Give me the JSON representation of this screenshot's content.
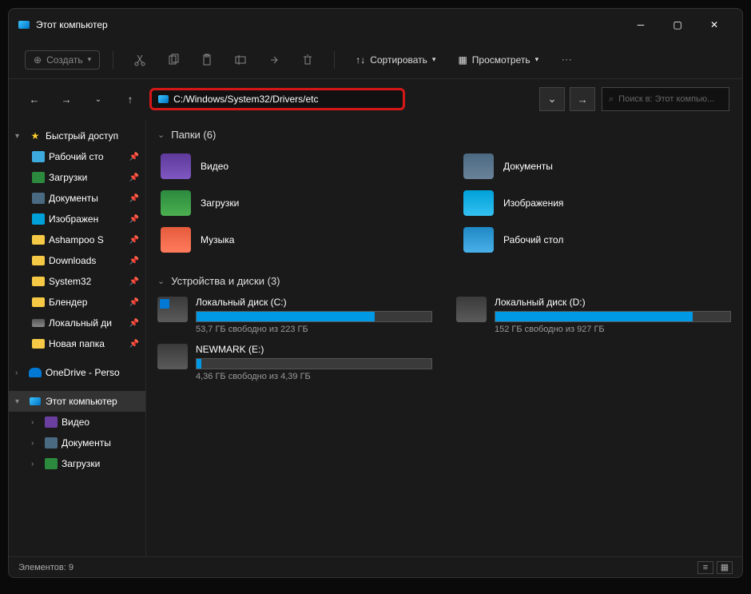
{
  "window": {
    "title": "Этот компьютер"
  },
  "toolbar": {
    "new_label": "Создать",
    "sort_label": "Сортировать",
    "view_label": "Просмотреть"
  },
  "address": {
    "path": "C:/Windows/System32/Drivers/etc",
    "search_placeholder": "Поиск в: Этот компью..."
  },
  "sidebar": {
    "quick_access": "Быстрый доступ",
    "items": [
      {
        "label": "Рабочий сто",
        "icon": "desk"
      },
      {
        "label": "Загрузки",
        "icon": "dl"
      },
      {
        "label": "Документы",
        "icon": "doc"
      },
      {
        "label": "Изображен",
        "icon": "img"
      },
      {
        "label": "Ashampoo S",
        "icon": "folder"
      },
      {
        "label": "Downloads",
        "icon": "folder"
      },
      {
        "label": "System32",
        "icon": "folder"
      },
      {
        "label": "Блендер",
        "icon": "folder"
      },
      {
        "label": "Локальный ди",
        "icon": "hdd"
      },
      {
        "label": "Новая папка",
        "icon": "folder"
      }
    ],
    "onedrive": "OneDrive - Perso",
    "this_pc": "Этот компьютер",
    "pc_items": [
      {
        "label": "Видео",
        "icon": "vid"
      },
      {
        "label": "Документы",
        "icon": "doc"
      },
      {
        "label": "Загрузки",
        "icon": "dl"
      }
    ]
  },
  "main": {
    "folders_header": "Папки (6)",
    "folders": [
      {
        "label": "Видео",
        "icon": "fi-vid"
      },
      {
        "label": "Документы",
        "icon": "fi-doc"
      },
      {
        "label": "Загрузки",
        "icon": "fi-dl"
      },
      {
        "label": "Изображения",
        "icon": "fi-img"
      },
      {
        "label": "Музыка",
        "icon": "fi-mus"
      },
      {
        "label": "Рабочий стол",
        "icon": "fi-desk"
      }
    ],
    "drives_header": "Устройства и диски (3)",
    "drives": [
      {
        "name": "Локальный диск (C:)",
        "free": "53,7 ГБ свободно из 223 ГБ",
        "pct": 76,
        "os": true
      },
      {
        "name": "Локальный диск (D:)",
        "free": "152 ГБ свободно из 927 ГБ",
        "pct": 84,
        "os": false
      },
      {
        "name": "NEWMARK (E:)",
        "free": "4,36 ГБ свободно из 4,39 ГБ",
        "pct": 2,
        "os": false
      }
    ]
  },
  "statusbar": {
    "count": "Элементов: 9"
  }
}
